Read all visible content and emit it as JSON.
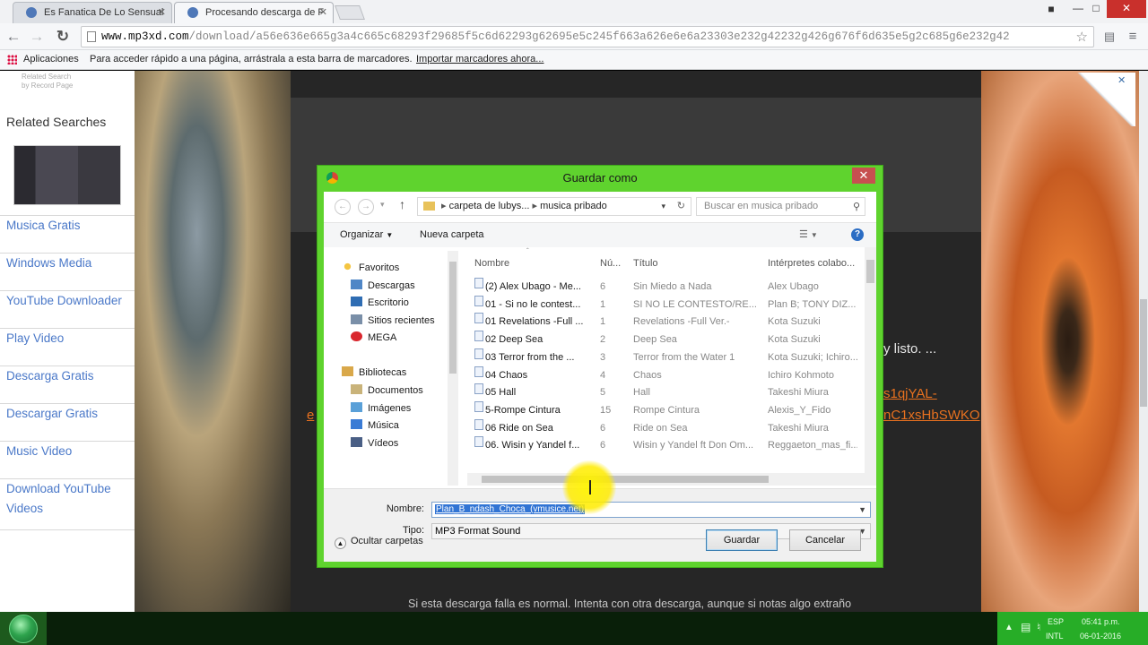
{
  "browser": {
    "tabs": [
      {
        "label": "Es Fanatica De Lo Sensual"
      },
      {
        "label": "Procesando descarga de F"
      }
    ],
    "url": {
      "domain": "www.mp3xd.com",
      "path": "/download/a56e636e665g3a4c665c68293f29685f5c6d62293g62695e5c245f663a626e6e6a23303e232g42232g426g676f6d635e5g2c685g6e232g42"
    },
    "bookmarks": {
      "apps_label": "Aplicaciones",
      "hint": "Para acceder rápido a una página, arrástrala a esta barra de marcadores.",
      "import_label": "Importar marcadores ahora..."
    }
  },
  "sidebar": {
    "tiny_caption_1": "Related Search",
    "tiny_caption_2": "by Record Page",
    "title": "Related Searches",
    "links": [
      "Musica Gratis",
      "Windows Media",
      "YouTube Downloader",
      "Play Video",
      "Descarga Gratis",
      "Descargar Gratis",
      "Music Video",
      "Download YouTube Videos"
    ]
  },
  "page_bg": {
    "text_listo": "y listo. ...",
    "orange_1": "s1qjYAL-",
    "orange_2": "nC1xsHbSWKO",
    "orange_left": "e",
    "bottom_note": "Si esta descarga falla es normal. Intenta con otra descarga, aunque si notas algo extraño"
  },
  "dialog": {
    "title": "Guardar como",
    "path": {
      "seg1": "carpeta de lubys...",
      "seg2": "musica pribado"
    },
    "search_placeholder": "Buscar en musica pribado",
    "organize_label": "Organizar",
    "new_folder_label": "Nueva carpeta",
    "nav": {
      "favorites_label": "Favoritos",
      "favorites": [
        "Descargas",
        "Escritorio",
        "Sitios recientes",
        "MEGA"
      ],
      "libraries_label": "Bibliotecas",
      "libraries": [
        "Documentos",
        "Imágenes",
        "Música",
        "Vídeos"
      ]
    },
    "columns": {
      "name": "Nombre",
      "num": "Nú...",
      "title": "Título",
      "artists": "Intérpretes colabo..."
    },
    "files": [
      {
        "name": "(2) Alex Ubago - Me...",
        "num": "6",
        "title": "Sin Miedo a Nada",
        "artist": "Alex Ubago"
      },
      {
        "name": "01 - Si no le contest...",
        "num": "1",
        "title": "SI NO LE CONTESTO/RE...",
        "artist": "Plan B; TONY DIZ..."
      },
      {
        "name": "01 Revelations -Full ...",
        "num": "1",
        "title": "Revelations -Full Ver.-",
        "artist": "Kota Suzuki"
      },
      {
        "name": "02 Deep Sea",
        "num": "2",
        "title": "Deep Sea",
        "artist": "Kota Suzuki"
      },
      {
        "name": "03 Terror from the ...",
        "num": "3",
        "title": "Terror from the Water 1",
        "artist": "Kota Suzuki; Ichiro..."
      },
      {
        "name": "04 Chaos",
        "num": "4",
        "title": "Chaos",
        "artist": "Ichiro Kohmoto"
      },
      {
        "name": "05 Hall",
        "num": "5",
        "title": "Hall",
        "artist": "Takeshi Miura"
      },
      {
        "name": "5-Rompe Cintura",
        "num": "15",
        "title": "Rompe Cintura",
        "artist": "Alexis_Y_Fido"
      },
      {
        "name": "06 Ride on Sea",
        "num": "6",
        "title": "Ride on Sea",
        "artist": "Takeshi Miura"
      },
      {
        "name": "06. Wisin y Yandel f...",
        "num": "6",
        "title": "Wisin y Yandel ft Don Om...",
        "artist": "Reggaeton_mas_fi..."
      }
    ],
    "filename_label": "Nombre:",
    "filename_value": "Plan_B_ndash_Choca_(vmusice.net)",
    "type_label": "Tipo:",
    "type_value": "MP3 Format Sound",
    "hide_folders_label": "Ocultar carpetas",
    "save_label": "Guardar",
    "cancel_label": "Cancelar"
  },
  "taskbar": {
    "lang": "ESP",
    "layout": "INTL",
    "time": "05:41 p.m.",
    "date": "06-01-2016"
  },
  "colors": {
    "dialog_frame": "#5fd32e",
    "link_blue": "#4a78c8",
    "accent_orange": "#e8711f",
    "tray_green": "#27ad27"
  }
}
